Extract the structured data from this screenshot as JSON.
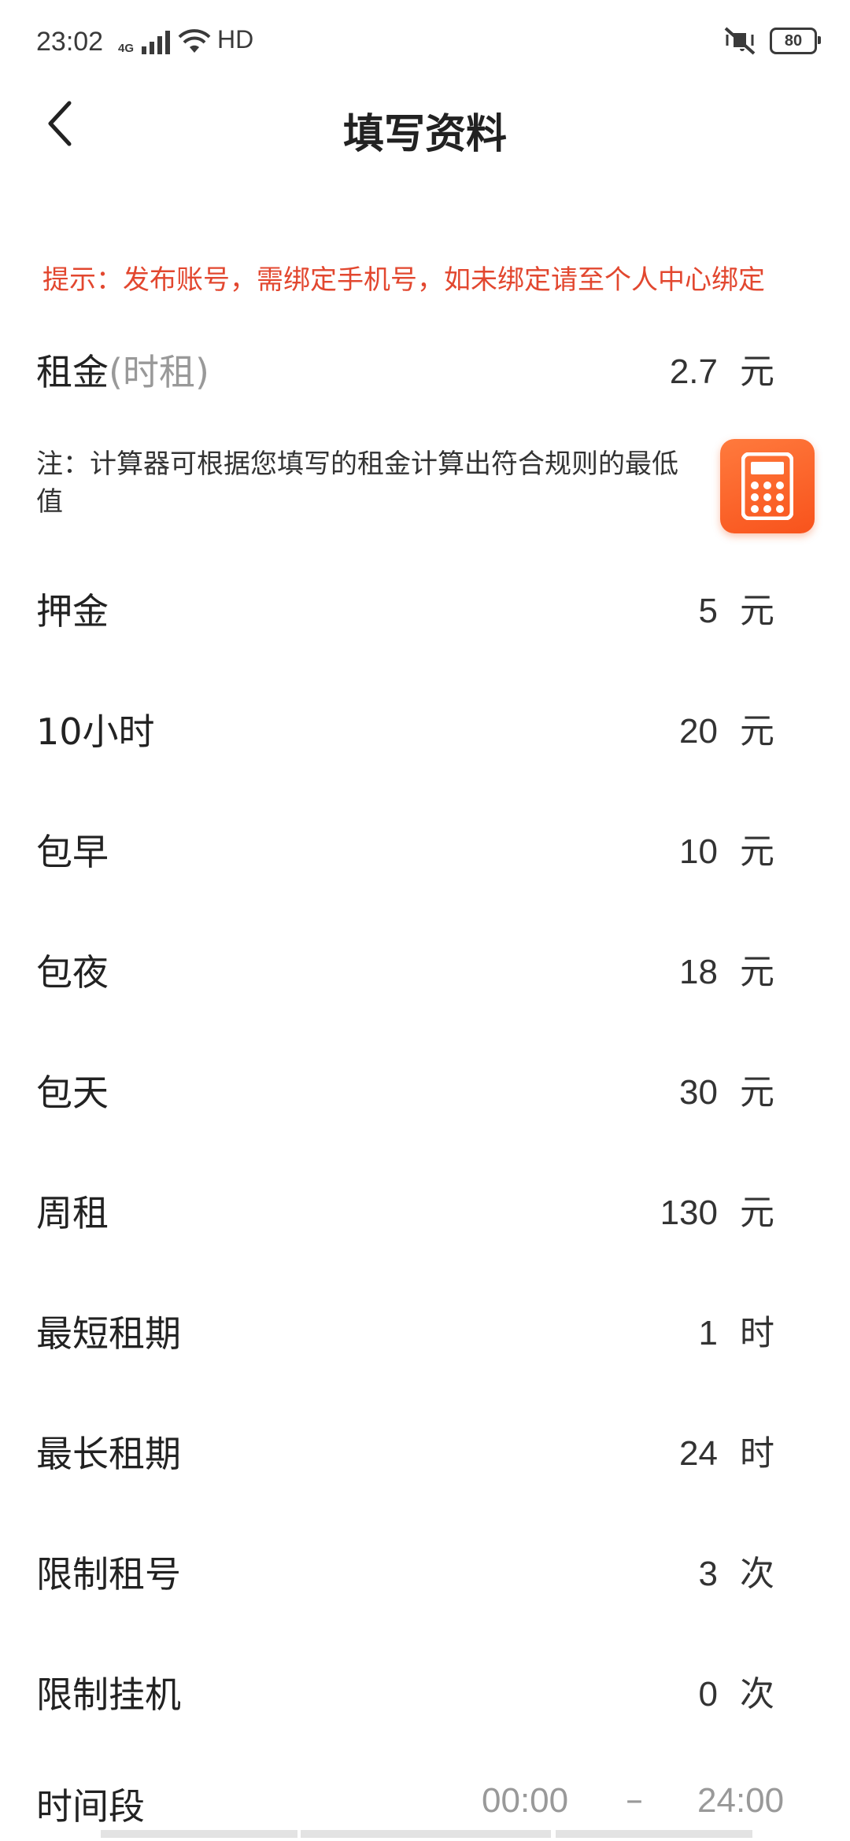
{
  "status_bar": {
    "time": "23:02",
    "network": "4G",
    "hd": "HD",
    "battery": "80",
    "icons": [
      "signal-icon",
      "wifi-icon",
      "mute-vibrate-icon",
      "battery-icon"
    ]
  },
  "nav": {
    "title": "填写资料",
    "back_icon": "chevron-left-icon"
  },
  "hint": "提示：发布账号，需绑定手机号，如未绑定请至个人中心绑定",
  "rent": {
    "label": "租金",
    "sublabel": "(时租)",
    "value": "2.7",
    "unit": "元"
  },
  "note": {
    "text": "注：计算器可根据您填写的租金计算出符合规则的最低值",
    "calculator_icon": "calculator-icon"
  },
  "fields": [
    {
      "label": "押金",
      "value": "5",
      "unit": "元"
    },
    {
      "label": "10小时",
      "value": "20",
      "unit": "元"
    },
    {
      "label": "包早",
      "value": "10",
      "unit": "元"
    },
    {
      "label": "包夜",
      "value": "18",
      "unit": "元"
    },
    {
      "label": "包天",
      "value": "30",
      "unit": "元"
    },
    {
      "label": "周租",
      "value": "130",
      "unit": "元"
    },
    {
      "label": "最短租期",
      "value": "1",
      "unit": "时"
    },
    {
      "label": "最长租期",
      "value": "24",
      "unit": "时"
    },
    {
      "label": "限制租号",
      "value": "3",
      "unit": "次"
    },
    {
      "label": "限制挂机",
      "value": "0",
      "unit": "次"
    }
  ],
  "time_range": {
    "label": "时间段",
    "start": "00:00",
    "separator": "–",
    "end": "24:00"
  },
  "colors": {
    "accent": "#e2472f",
    "calculator": "#f8531c",
    "muted": "#999999"
  }
}
